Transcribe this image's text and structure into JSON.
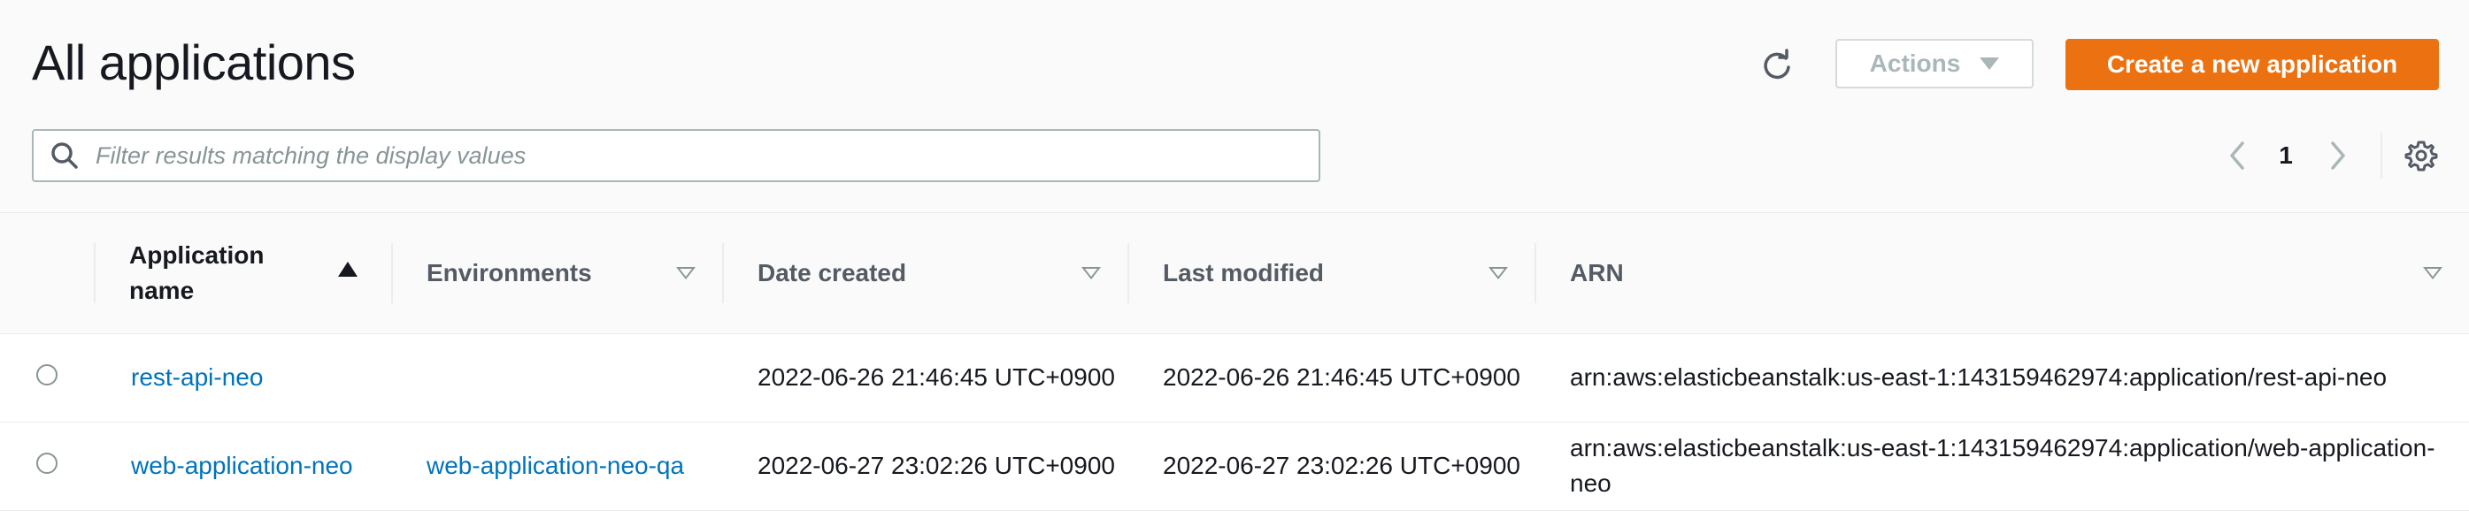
{
  "header": {
    "title": "All applications",
    "actions_label": "Actions",
    "create_label": "Create a new application"
  },
  "search": {
    "placeholder": "Filter results matching the display values",
    "value": ""
  },
  "pagination": {
    "current_page": "1"
  },
  "columns": {
    "name_line1": "Application",
    "name_line2": "name",
    "environments": "Environments",
    "date_created": "Date created",
    "last_modified": "Last modified",
    "arn": "ARN"
  },
  "rows": [
    {
      "name": "rest-api-neo",
      "environment": "",
      "date_created": "2022-06-26 21:46:45 UTC+0900",
      "last_modified": "2022-06-26 21:46:45 UTC+0900",
      "arn": "arn:aws:elasticbeanstalk:us-east-1:143159462974:application/rest-api-neo"
    },
    {
      "name": "web-application-neo",
      "environment": "web-application-neo-qa",
      "date_created": "2022-06-27 23:02:26 UTC+0900",
      "last_modified": "2022-06-27 23:02:26 UTC+0900",
      "arn": "arn:aws:elasticbeanstalk:us-east-1:143159462974:application/web-application-neo"
    }
  ],
  "colors": {
    "accent": "#ec7211",
    "link": "#0073bb",
    "header_bg": "#fafafa"
  },
  "icons": [
    "refresh-icon",
    "caret-down-icon",
    "search-icon",
    "chevron-left-icon",
    "chevron-right-icon",
    "gear-icon",
    "sort-ascending-icon",
    "filter-caret-icon"
  ]
}
